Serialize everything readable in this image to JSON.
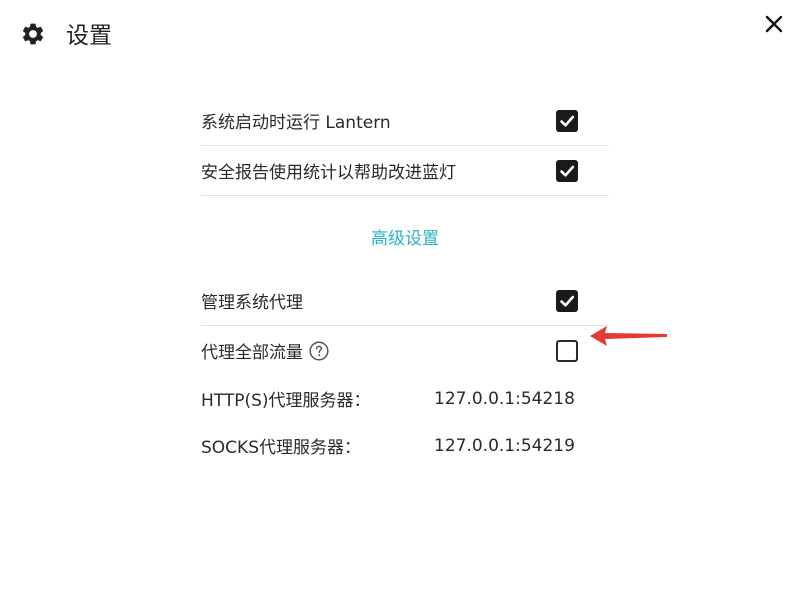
{
  "header": {
    "icon": "gear-icon",
    "title": "设置",
    "close_icon": "close-icon"
  },
  "settings": [
    {
      "label": "系统启动时运行 Lantern",
      "checked": true
    },
    {
      "label": "安全报告使用统计以帮助改进蓝灯",
      "checked": true
    }
  ],
  "advanced": {
    "heading": "高级设置",
    "items": [
      {
        "label": "管理系统代理",
        "checked": true
      },
      {
        "label": "代理全部流量",
        "checked": false,
        "help_icon": "help-circle-icon"
      }
    ]
  },
  "servers": [
    {
      "key": "HTTP(S)代理服务器：",
      "value": "127.0.0.1:54218"
    },
    {
      "key": "SOCKS代理服务器：",
      "value": "127.0.0.1:54219"
    }
  ],
  "annotation": {
    "arrow_color": "#e53935"
  }
}
